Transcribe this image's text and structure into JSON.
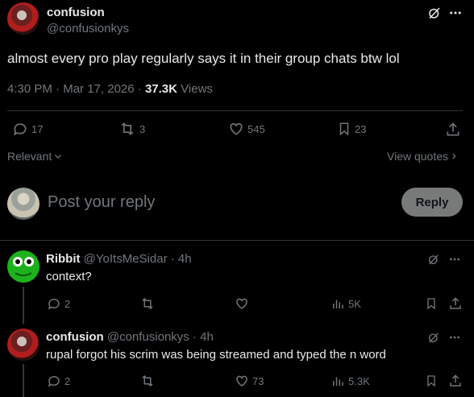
{
  "main_post": {
    "display_name": "confusion",
    "handle": "@confusionkys",
    "text": "almost every pro play regularly says it in their group chats btw lol",
    "time": "4:30 PM",
    "sep1": "·",
    "date": "Mar 17, 2026",
    "sep2": "·",
    "views_count": "37.3K",
    "views_label": "Views",
    "actions": {
      "replies": "17",
      "reposts": "3",
      "likes": "545",
      "bookmarks": "23"
    }
  },
  "sort": {
    "label": "Relevant",
    "view_quotes": "View quotes"
  },
  "composer": {
    "placeholder": "Post your reply",
    "reply_button": "Reply"
  },
  "replies": [
    {
      "display_name": "Ribbit",
      "handle": "@YoItsMeSidar",
      "sep": "·",
      "age": "4h",
      "text": "context?",
      "replies": "2",
      "likes": "",
      "views": "5K"
    },
    {
      "display_name": "confusion",
      "handle": "@confusionkys",
      "sep": "·",
      "age": "4h",
      "text": "rupal forgot his scrim was being streamed and typed the n word",
      "replies": "2",
      "likes": "73",
      "views": "5.3K"
    }
  ],
  "colors": {
    "background": "#000000",
    "text": "#e7e9ea",
    "muted": "#71767b",
    "divider": "#2f3336",
    "reply_button_bg": "#787a7a"
  },
  "icons": [
    "grok-icon",
    "more-icon",
    "reply-icon",
    "repost-icon",
    "like-icon",
    "bookmark-icon",
    "share-icon",
    "views-icon",
    "chevron-down-icon",
    "chevron-right-icon"
  ]
}
